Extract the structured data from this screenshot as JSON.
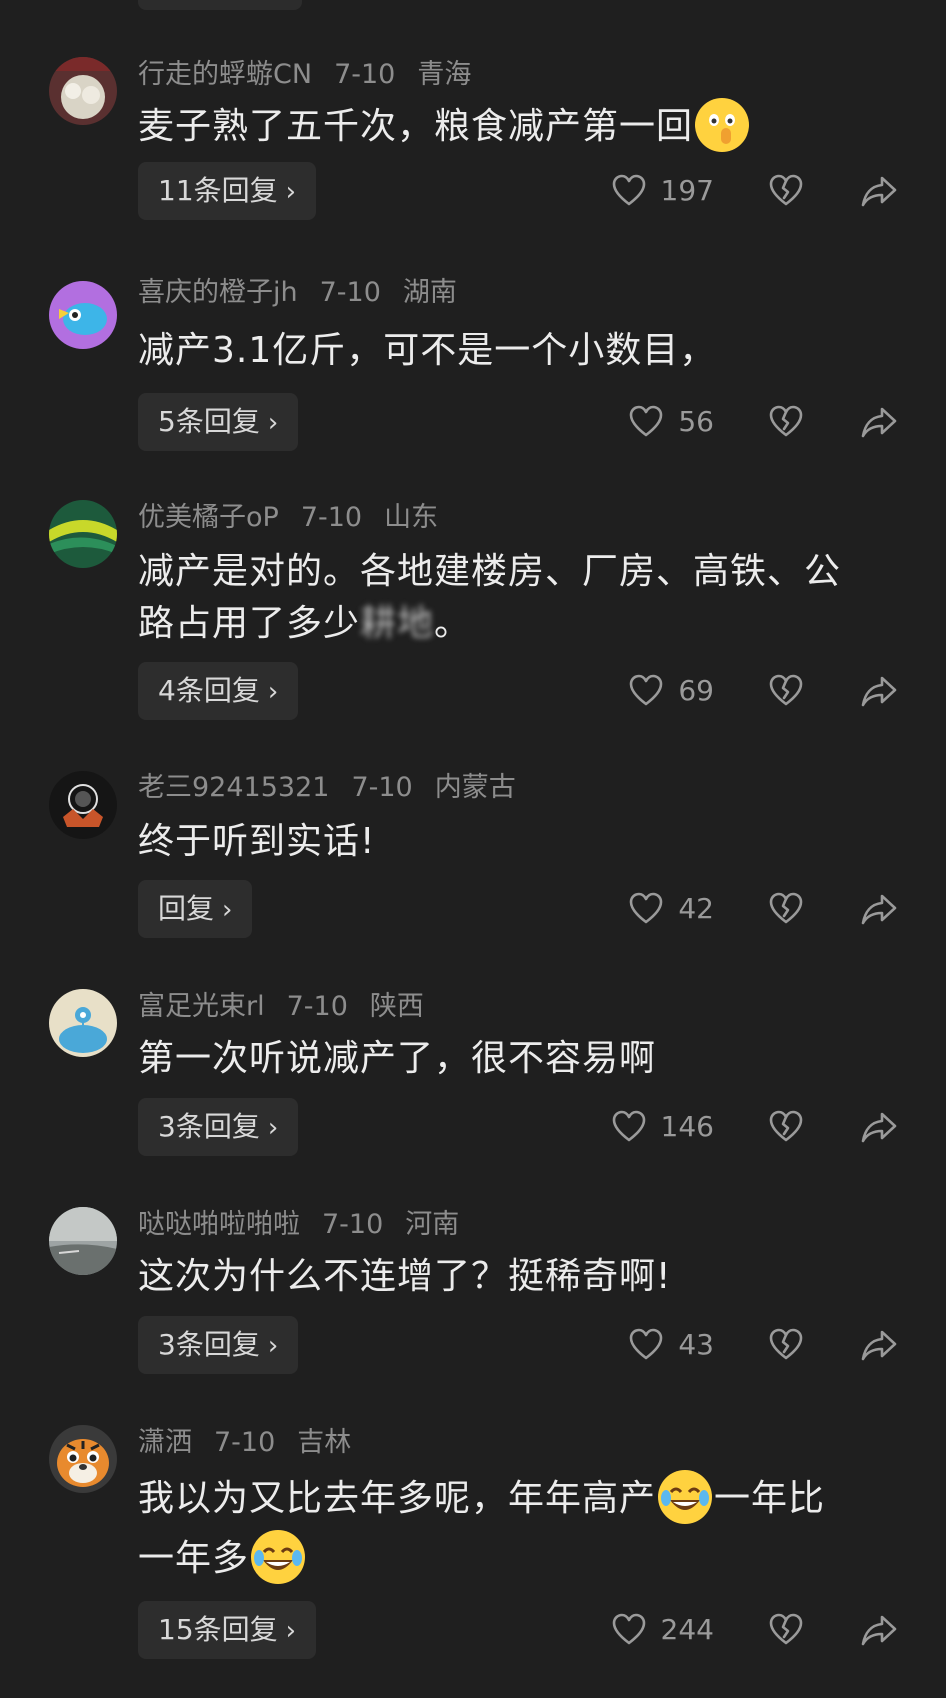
{
  "comments": [
    {
      "user": "行走的蜉蝣CN",
      "date": "7-10",
      "location": "青海",
      "text": "麦子熟了五千次，粮食减产第一回",
      "emoji": "shushing-face",
      "reply": "11条回复",
      "likes": "197"
    },
    {
      "user": "喜庆的橙子jh",
      "date": "7-10",
      "location": "湖南",
      "text": "减产3.1亿斤，可不是一个小数目，",
      "reply": "5条回复",
      "likes": "56"
    },
    {
      "user": "优美橘子oP",
      "date": "7-10",
      "location": "山东",
      "text_line1": "减产是对的。各地建楼房、厂房、高铁、公",
      "text_line2a": "路占用了多少",
      "text_line2_blur": "耕地",
      "text_line2b": "。",
      "reply": "4条回复",
      "likes": "69"
    },
    {
      "user": "老三92415321",
      "date": "7-10",
      "location": "内蒙古",
      "text": "终于听到实话!",
      "reply": "回复",
      "likes": "42"
    },
    {
      "user": "富足光束rl",
      "date": "7-10",
      "location": "陕西",
      "text": "第一次听说减产了，很不容易啊",
      "reply": "3条回复",
      "likes": "146"
    },
    {
      "user": "哒哒啪啦啪啦",
      "date": "7-10",
      "location": "河南",
      "text": "这次为什么不连增了？挺稀奇啊!",
      "reply": "3条回复",
      "likes": "43"
    },
    {
      "user": "潇洒",
      "date": "7-10",
      "location": "吉林",
      "text_line1a": "我以为又比去年多呢，年年高产",
      "text_line1b": "一年比",
      "text_line2a": "一年多",
      "emoji": "tears-of-joy",
      "reply": "15条回复",
      "likes": "244"
    }
  ],
  "colors": {
    "background": "#1f1f1f",
    "meta": "#8d8d8d",
    "text": "#ececec",
    "button": "#2d2d2d"
  }
}
